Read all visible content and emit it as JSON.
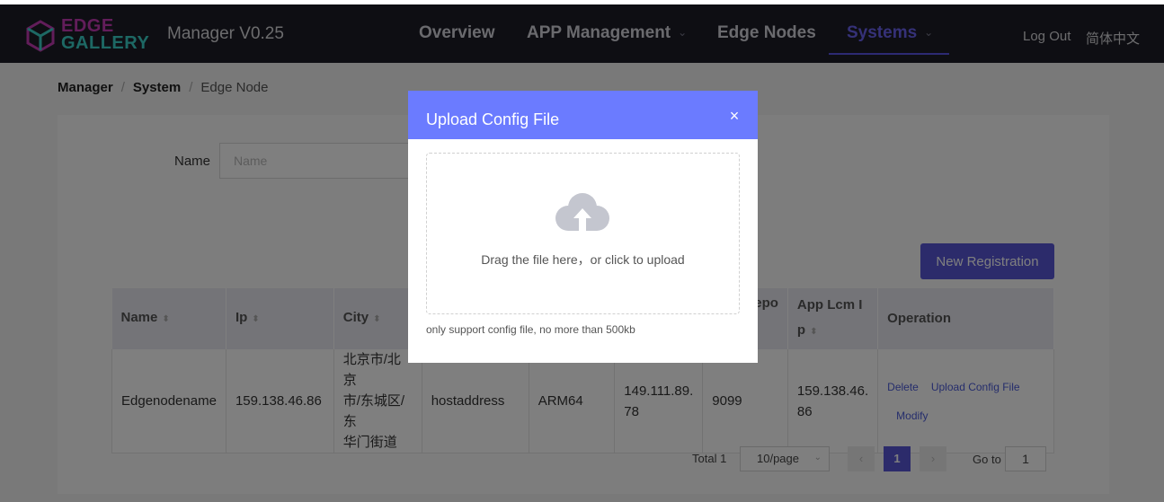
{
  "brand": {
    "line1": "EDGE",
    "line2": "GALLERY"
  },
  "app_title": "Manager V0.25",
  "nav": {
    "items": [
      {
        "label": "Overview"
      },
      {
        "label": "APP Management"
      },
      {
        "label": "Edge Nodes"
      },
      {
        "label": "Systems"
      }
    ],
    "chevron": "⌄",
    "logout": "Log Out",
    "language": "简体中文"
  },
  "breadcrumb": {
    "root": "Manager",
    "section": "System",
    "page": "Edge Node",
    "separator": "/"
  },
  "search": {
    "label": "Name",
    "placeholder": "Name"
  },
  "new_registration": "New Registration",
  "table": {
    "headers": {
      "name": "Name",
      "ip": "Ip",
      "city": "City",
      "repo": "epo",
      "applcm_line1": "App Lcm I",
      "applcm_line2": "p",
      "operation": "Operation"
    },
    "sort_icon": "⬍",
    "row": {
      "name": "Edgenodename",
      "ip": "159.138.46.86",
      "city_line1": "北京市/北京",
      "city_line2": "市/东城区/东",
      "city_line3": "华门街道",
      "address": "hostaddress",
      "arch": "ARM64",
      "ip2_line1": "149.111.89.",
      "ip2_line2": "78",
      "port": "9099",
      "lcm_line1": "159.138.46.",
      "lcm_line2": "86",
      "op_delete": "Delete",
      "op_upload": "Upload Config File",
      "op_modify": "Modify"
    }
  },
  "pagination": {
    "total": "Total 1",
    "page_size": "10/page",
    "prev": "‹",
    "next": "›",
    "current": "1",
    "goto_label": "Go to",
    "goto_value": "1"
  },
  "dialog": {
    "title": "Upload Config File",
    "close": "×",
    "drop_text": "Drag the file here，or click to upload",
    "tip": "only support config file, no more than 500kb"
  },
  "colors": {
    "nav_bg": "#1d1d26",
    "accent": "#5856d6",
    "dialog_header": "#6b7bff"
  }
}
